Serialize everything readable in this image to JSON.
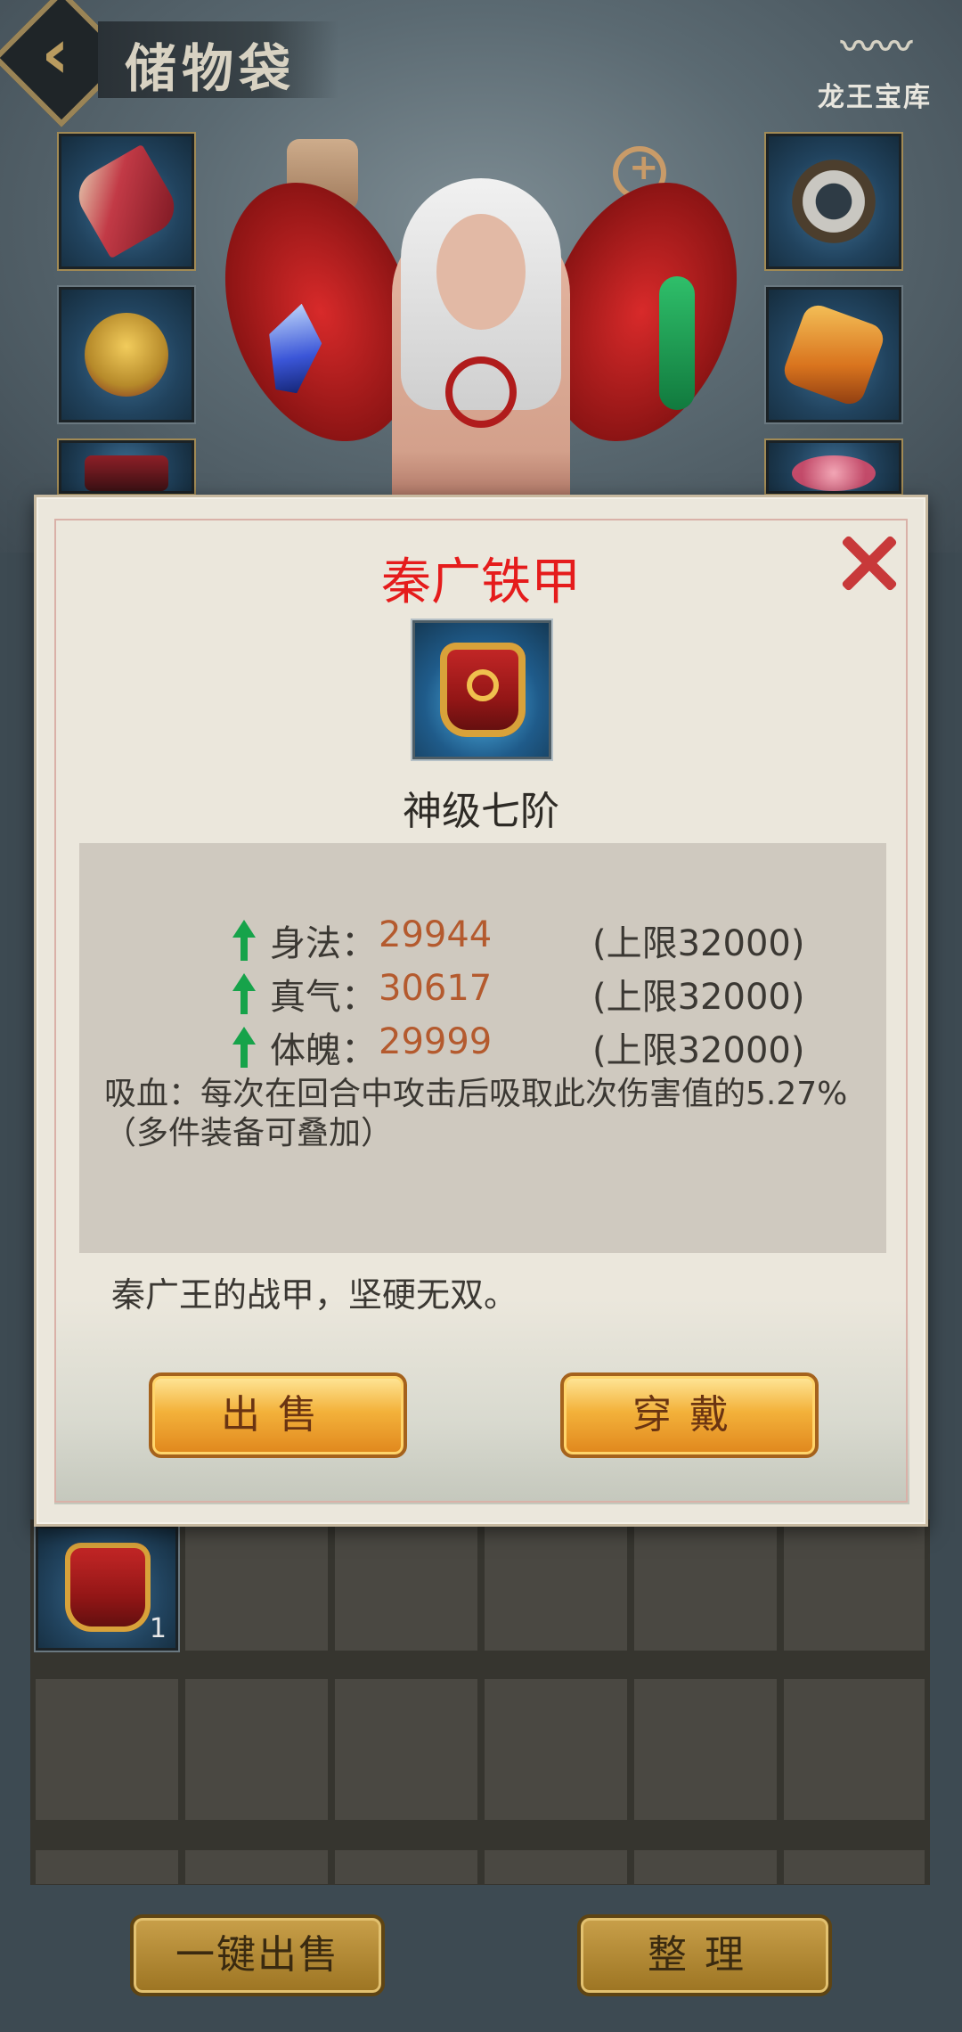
{
  "header": {
    "title": "储物袋",
    "brand": "龙王宝库"
  },
  "equipment_slots": [
    {
      "name": "weapon",
      "icon": "sword-icon"
    },
    {
      "name": "helmet",
      "icon": "lion-helmet-icon"
    },
    {
      "name": "belt",
      "icon": "belt-icon"
    },
    {
      "name": "ring",
      "icon": "ring-icon"
    },
    {
      "name": "pendant",
      "icon": "amber-gem-icon"
    },
    {
      "name": "bracelet",
      "icon": "bracelet-icon"
    }
  ],
  "item_popup": {
    "title": "秦广铁甲",
    "grade": "神级七阶",
    "stats": [
      {
        "label": "身法：",
        "value": "29944",
        "cap": "(上限32000)"
      },
      {
        "label": "真气：",
        "value": "30617",
        "cap": "(上限32000)"
      },
      {
        "label": "体魄：",
        "value": "29999",
        "cap": "(上限32000)"
      }
    ],
    "effect": "吸血：每次在回合中攻击后吸取此次伤害值的5.27%（多件装备可叠加）",
    "description": "秦广王的战甲，坚硬无双。",
    "sell_label": "出售",
    "wear_label": "穿戴",
    "title_color": "#e51c1c",
    "stat_value_color": "#b45a2e",
    "arrow_color": "#16a34a"
  },
  "inventory": {
    "items": [
      {
        "icon": "armor-icon",
        "count": "1"
      }
    ]
  },
  "footer": {
    "sell_all_label": "一键出售",
    "sort_label": "整理"
  }
}
